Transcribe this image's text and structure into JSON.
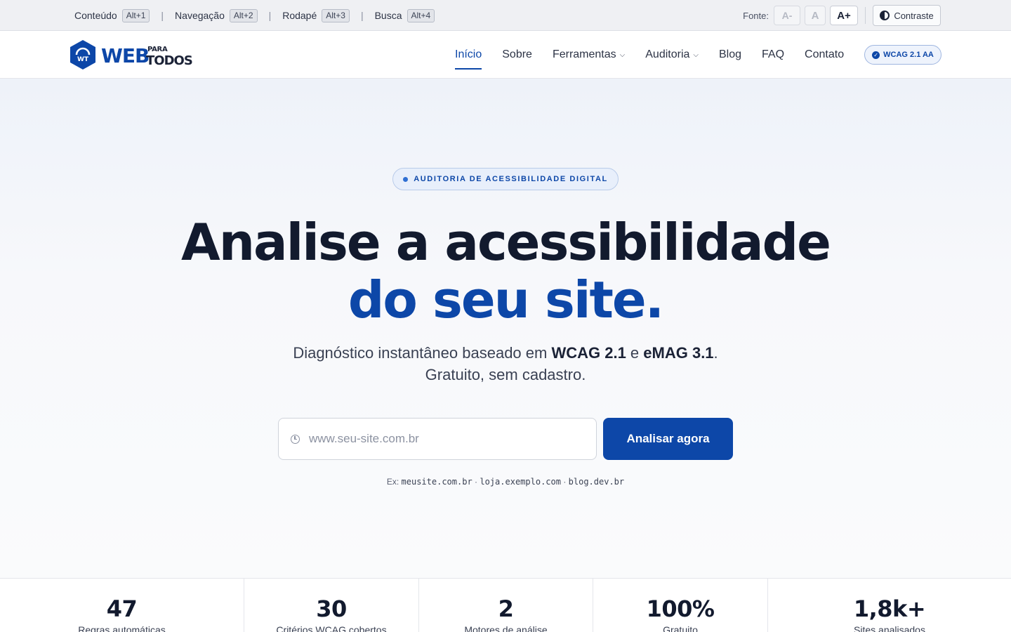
{
  "skip_links": [
    {
      "label": "Conteúdo",
      "key": "Alt+1"
    },
    {
      "label": "Navegação",
      "key": "Alt+2"
    },
    {
      "label": "Rodapé",
      "key": "Alt+3"
    },
    {
      "label": "Busca",
      "key": "Alt+4"
    }
  ],
  "font_controls": {
    "label": "Fonte:",
    "decrease": "A-",
    "normal": "A",
    "increase": "A+"
  },
  "contrast": {
    "label": "Contraste",
    "icon": "contrast-icon"
  },
  "logo": {
    "mark": "WT",
    "web": "WEB",
    "para": "PARA",
    "todos": "TODOS"
  },
  "nav": {
    "items": [
      {
        "label": "Início",
        "active": true
      },
      {
        "label": "Sobre"
      },
      {
        "label": "Ferramentas",
        "dropdown": true
      },
      {
        "label": "Auditoria",
        "dropdown": true
      },
      {
        "label": "Blog"
      },
      {
        "label": "FAQ"
      },
      {
        "label": "Contato"
      }
    ],
    "badge": "WCAG 2.1 AA"
  },
  "hero": {
    "eyebrow": "AUDITORIA DE ACESSIBILIDADE DIGITAL",
    "title_line1": "Analise a acessibilidade",
    "title_line2": "do seu site.",
    "subtitle_pre": "Diagnóstico instantâneo baseado em ",
    "subtitle_b1": "WCAG 2.1",
    "subtitle_mid": " e ",
    "subtitle_b2": "eMAG 3.1",
    "subtitle_post": ".",
    "subtitle_line2": "Gratuito, sem cadastro.",
    "search_placeholder": "www.seu-site.com.br",
    "cta": "Analisar agora",
    "examples_prefix": "Ex:",
    "examples": [
      "meusite.com.br",
      "loja.exemplo.com",
      "blog.dev.br"
    ],
    "examples_sep": "·"
  },
  "stats": [
    {
      "value": "47",
      "label": "Regras automáticas"
    },
    {
      "value": "30",
      "label": "Critérios WCAG cobertos"
    },
    {
      "value": "2",
      "label": "Motores de análise"
    },
    {
      "value": "100%",
      "label": "Gratuito"
    },
    {
      "value": "1,8k+",
      "label": "Sites analisados"
    }
  ],
  "colors": {
    "brand": "#0d47a8",
    "ink": "#121a2e"
  }
}
